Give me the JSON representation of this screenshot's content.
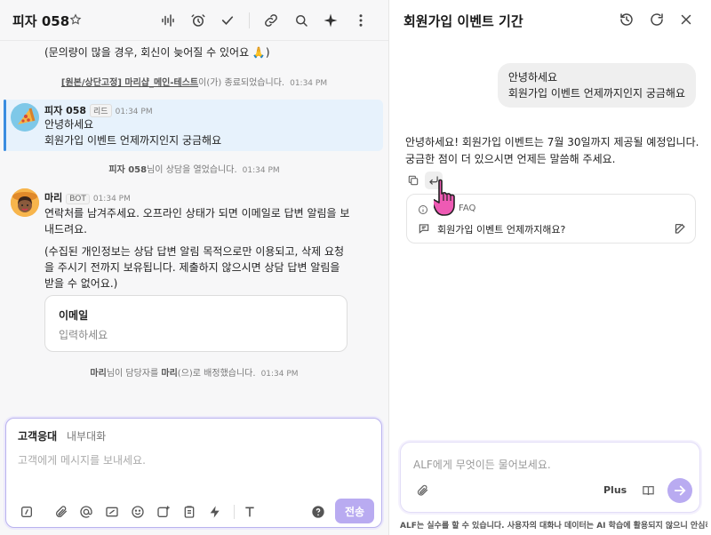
{
  "colors": {
    "accent": "#b9abf1",
    "highlight_bg": "#e7f2fc",
    "highlight_bar": "#3a8de0",
    "cursor": "#ee5ab4"
  },
  "left": {
    "title": "피자 058",
    "messages_top_text": "(문의량이 많을 경우, 회신이 늦어질 수 있어요 🙏)",
    "sys1": {
      "link": "[원본/상단고정] 마리샵_메인-테스트",
      "text": "이(가) 종료되었습니다.",
      "time": "01:34 PM"
    },
    "customer_msg": {
      "name": "피자 058",
      "badge": "리드",
      "time": "01:34 PM",
      "line1": "안녕하세요",
      "line2": "회원가입 이벤트 언제까지인지 궁금해요"
    },
    "sys2": {
      "name": "피자 058",
      "text": "님이 상담을 열었습니다.",
      "time": "01:34 PM"
    },
    "bot_msg": {
      "name": "마리",
      "badge": "BOT",
      "time": "01:34 PM",
      "p1_l1": "연락처를 남겨주세요. 오프라인 상태가 되면 이메일로 답변 알림을 보",
      "p1_l2": "내드려요.",
      "p2_l1": "(수집된 개인정보는 상담 답변 알림 목적으로만 이용되고, 삭제 요청",
      "p2_l2": "을 주시기 전까지 보유됩니다. 제출하지 않으시면 상담 답변 알림을",
      "p2_l3": "받을 수 없어요.)",
      "form_label": "이메일",
      "form_placeholder": "입력하세요"
    },
    "sys3": {
      "name1": "마리",
      "text1": "님이 담당자를 ",
      "name2": "마리",
      "text2": "(으)로 배정했습니다.",
      "time": "01:34 PM"
    },
    "composer": {
      "tab_active": "고객응대",
      "tab_inactive": "내부대화",
      "placeholder": "고객에게 메시지를 보내세요.",
      "send": "전송"
    }
  },
  "right": {
    "title": "회원가입 이벤트 기간",
    "user_l1": "안녕하세요",
    "user_l2": "회원가입 이벤트 언제까지인지 궁금해요",
    "answer_l1": "안녕하세요! 회원가입 이벤트는 7월 30일까지 제공될 예정입니다.",
    "answer_l2": "궁금한 점이 더 있으시면 언제든 말씀해 주세요.",
    "faq_label": "FAQ",
    "faq_item": "회원가입 이벤트 언제까지해요?",
    "input_placeholder": "ALF에게 무엇이든 물어보세요.",
    "plus": "Plus",
    "footer": "ALF는 실수를 할 수 있습니다. 사용자의 대화나 데이터는 AI 학습에 활용되지 않으니 안심하..."
  }
}
